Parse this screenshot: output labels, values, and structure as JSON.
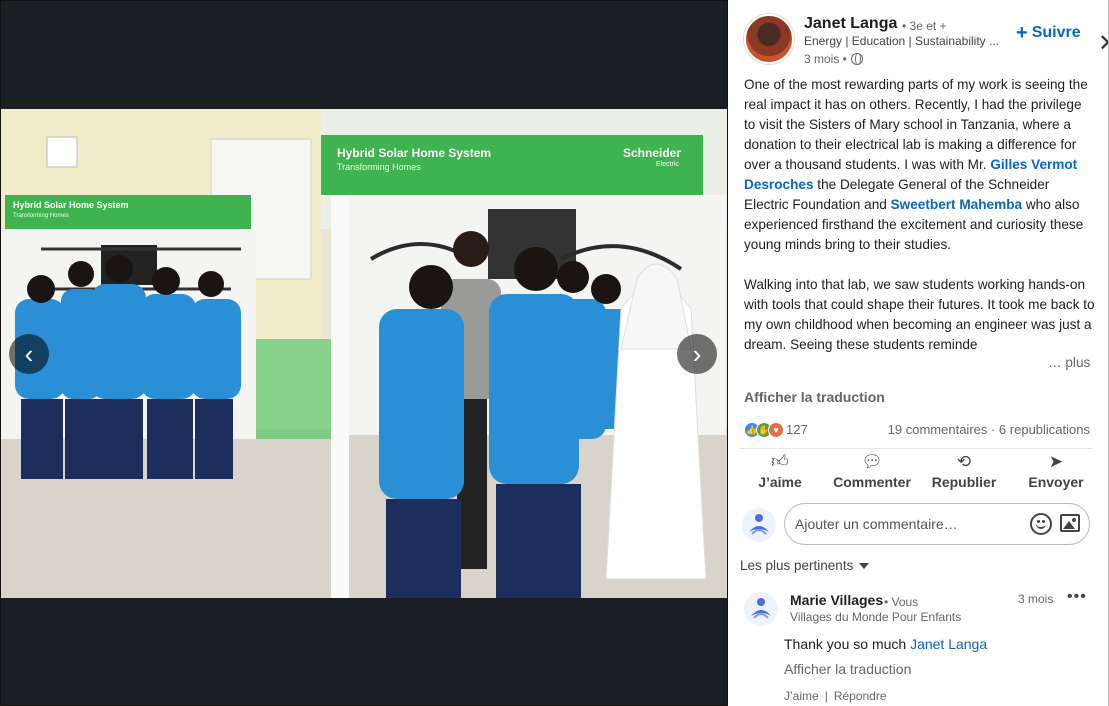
{
  "viewer": {
    "prev_glyph": "‹",
    "next_glyph": "›",
    "photo_texts": {
      "banner_left_title": "Hybrid Solar Home System",
      "banner_left_sub": "Transforming Homes",
      "banner_right_title": "Hybrid Solar Home System",
      "banner_right_sub": "Transforming Homes",
      "brand": "Schneider",
      "brand_sub": "Electric"
    }
  },
  "post": {
    "author": {
      "name": "Janet Langa",
      "degree": "• 3e et +",
      "headline": "Energy | Education | Sustainability ...",
      "time": "3 mois •"
    },
    "follow_label": "Suivre",
    "close_glyph": "✕",
    "text": {
      "p1_a": "One of the most rewarding parts of my work is seeing the real impact it has on others. Recently, I had the privilege to visit the Sisters of Mary school in Tanzania, where a donation to their electrical lab is making a difference for over a thousand students. I was with Mr. ",
      "mention1": "Gilles Vermot Desroches",
      "p1_b": " the Delegate General of the Schneider Electric Foundation and ",
      "mention2": "Sweetbert Mahemba",
      "p1_c": " who also experienced firsthand the excitement and curiosity these young minds bring to their studies.",
      "p2": "Walking into that lab, we saw students working hands-on with tools that could shape their futures. It took me back to my own childhood when becoming an engineer was just a dream. Seeing these students reminde"
    },
    "see_more": "… plus",
    "translate": "Afficher la traduction",
    "reactions_count": "127",
    "comments_reposts": "19 commentaires · 6 republications",
    "actions": {
      "like": "J’aime",
      "comment": "Commenter",
      "repost": "Republier",
      "send": "Envoyer"
    },
    "comment_placeholder": "Ajouter un commentaire…",
    "sort_label": "Les plus pertinents"
  },
  "comments": [
    {
      "name": "Marie Villages",
      "you": "• Vous",
      "headline": "Villages du Monde Pour Enfants",
      "time": "3 mois",
      "more": "•••",
      "text_prefix": "Thank you so much ",
      "mention": "Janet Langa",
      "translate": "Afficher la traduction",
      "like": "J’aime",
      "reply": "Répondre"
    }
  ],
  "colors": {
    "accent": "#0a66c2",
    "viewer_bg": "#1b1f23",
    "banner_green": "#3fb34f",
    "uniform_blue": "#2b8fd6"
  }
}
